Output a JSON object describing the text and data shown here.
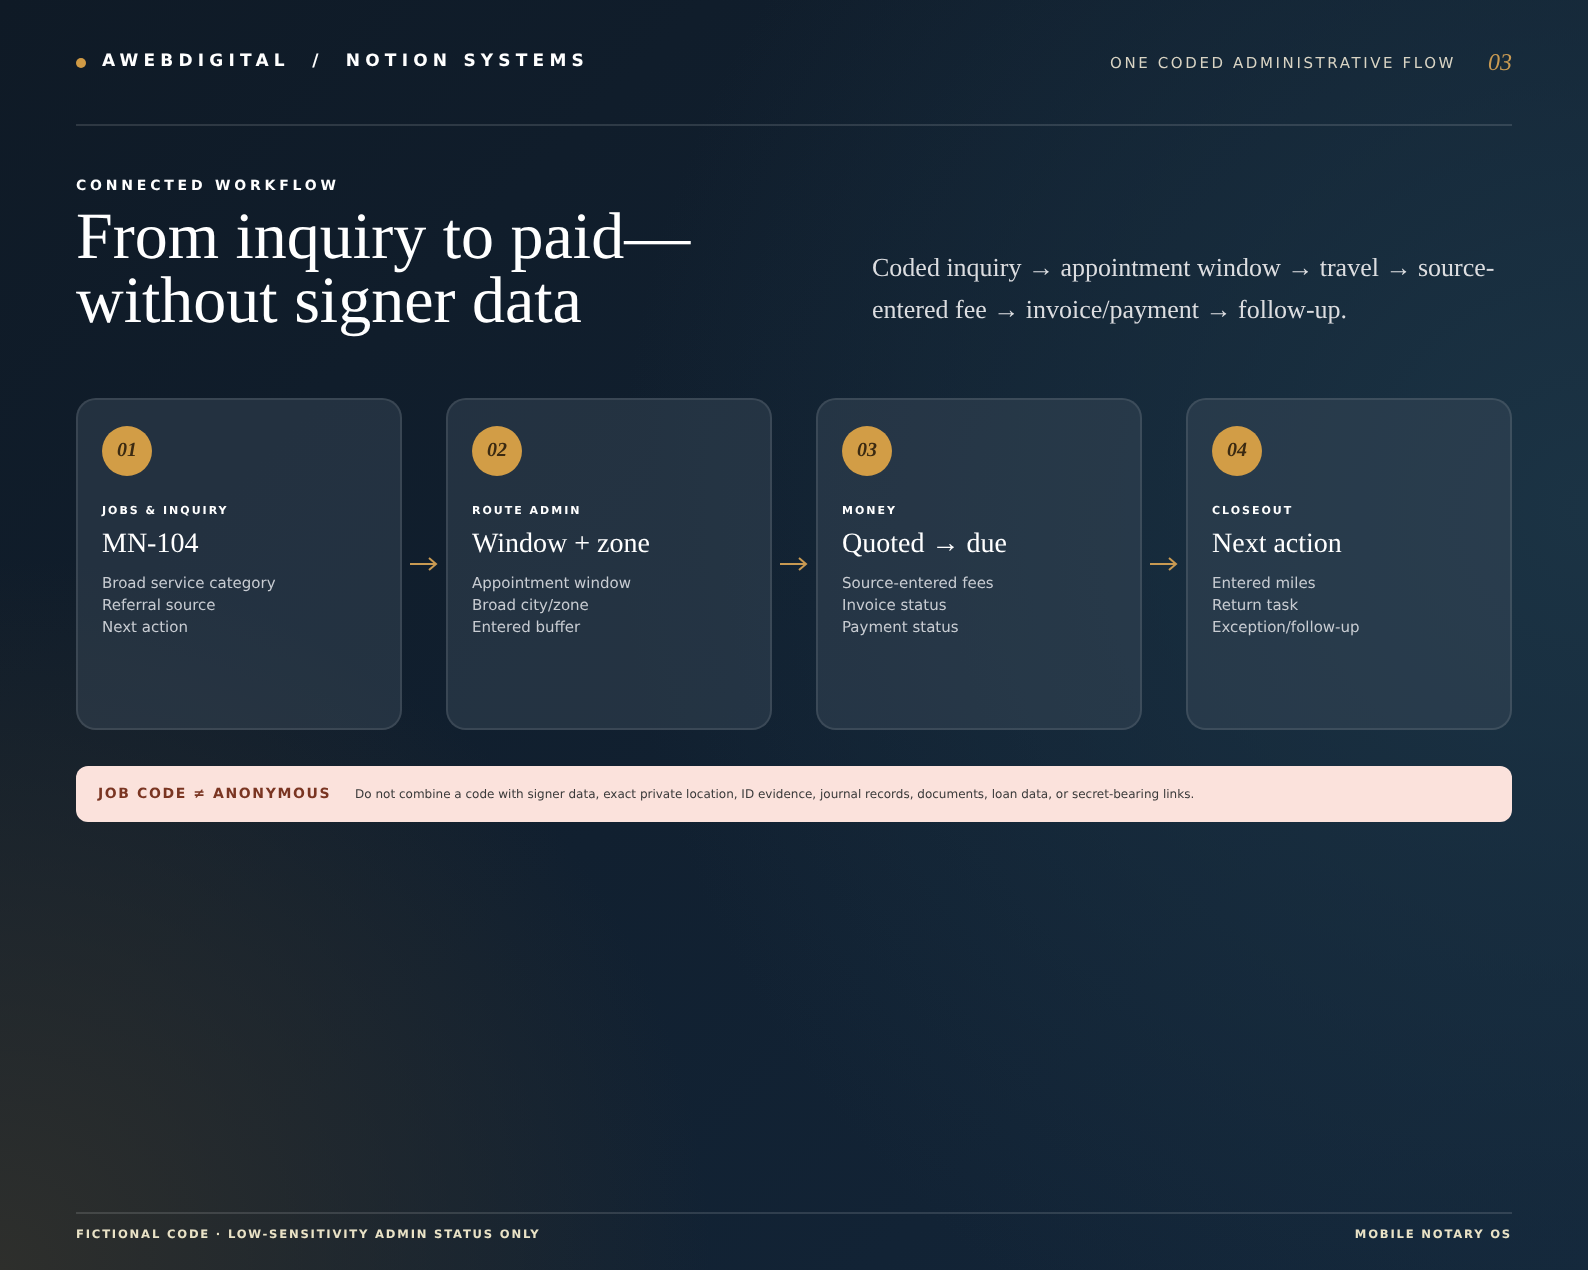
{
  "header": {
    "brand": "AWEBDIGITAL  /  NOTION SYSTEMS",
    "subtitle": "ONE CODED ADMINISTRATIVE FLOW",
    "page_number": "03"
  },
  "hero": {
    "eyebrow": "CONNECTED WORKFLOW",
    "title": "From inquiry to paid—without signer data",
    "summary": "Coded inquiry → appointment window → travel → source-entered fee → invoice/payment → follow-up."
  },
  "steps": [
    {
      "number": "01",
      "category": "JOBS & INQUIRY",
      "title": "MN-104",
      "lines": [
        "Broad service category",
        "Referral source",
        "Next action"
      ]
    },
    {
      "number": "02",
      "category": "ROUTE ADMIN",
      "title": "Window + zone",
      "lines": [
        "Appointment window",
        "Broad city/zone",
        "Entered buffer"
      ]
    },
    {
      "number": "03",
      "category": "MONEY",
      "title": "Quoted → due",
      "lines": [
        "Source-entered fees",
        "Invoice status",
        "Payment status"
      ]
    },
    {
      "number": "04",
      "category": "CLOSEOUT",
      "title": "Next action",
      "lines": [
        "Entered miles",
        "Return task",
        "Exception/follow-up"
      ]
    }
  ],
  "notice": {
    "label": "JOB CODE ≠ ANONYMOUS",
    "text": "Do not combine a code with signer data, exact private location, ID evidence, journal records, documents, loan data, or secret-bearing links."
  },
  "footer": {
    "left": "FICTIONAL CODE · LOW-SENSITIVITY ADMIN STATUS ONLY",
    "right": "MOBILE NOTARY OS"
  }
}
